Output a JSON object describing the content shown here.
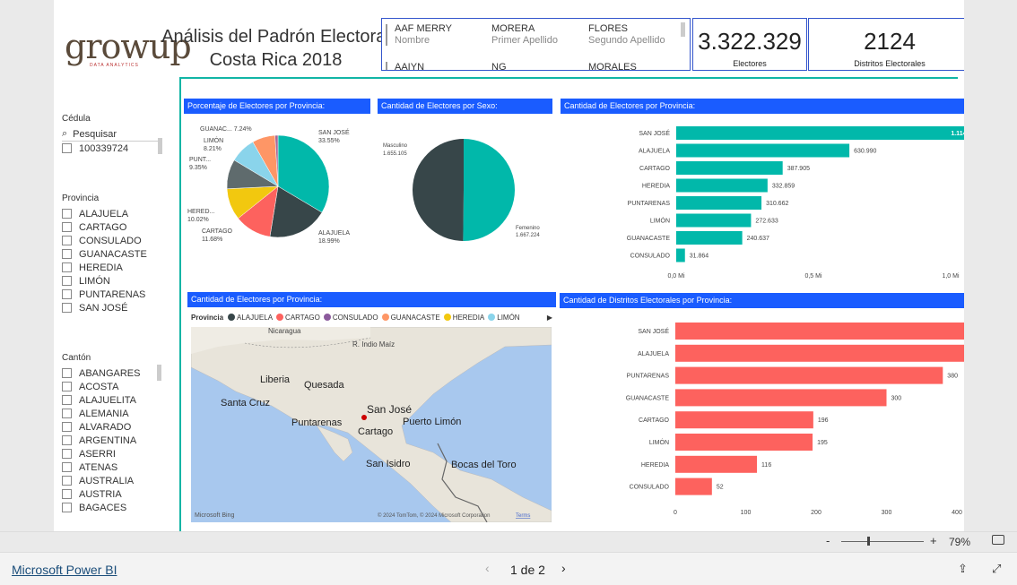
{
  "header": {
    "logo_main": "growup",
    "logo_sub": "DATA ANALYTICS",
    "title_line1": "Análisis del Padrón Electoral",
    "title_line2": "Costa Rica 2018"
  },
  "name_card": {
    "nombre_value": "AAF MERRY",
    "nombre_label": "Nombre",
    "primer_value": "MORERA",
    "primer_label": "Primer Apellido",
    "segundo_value": "FLORES",
    "segundo_label": "Segundo Apellido",
    "next_nombre": "AAIYN",
    "next_primer": "NG",
    "next_segundo": "MORALES"
  },
  "kpi_electores": {
    "value": "3.322.329",
    "label": "Electores"
  },
  "kpi_distritos": {
    "value": "2124",
    "label": "Distritos Electorales"
  },
  "slicer_cedula": {
    "label": "Cédula",
    "search_placeholder": "Pesquisar",
    "items": [
      "100339724"
    ]
  },
  "slicer_provincia": {
    "label": "Provincia",
    "items": [
      "ALAJUELA",
      "CARTAGO",
      "CONSULADO",
      "GUANACASTE",
      "HEREDIA",
      "LIMÓN",
      "PUNTARENAS",
      "SAN JOSÉ"
    ]
  },
  "slicer_canton": {
    "label": "Cantón",
    "items": [
      "ABANGARES",
      "ACOSTA",
      "ALAJUELITA",
      "ALEMANIA",
      "ALVARADO",
      "ARGENTINA",
      "ASERRI",
      "ATENAS",
      "AUSTRALIA",
      "AUSTRIA",
      "BAGACES"
    ]
  },
  "visual_titles": {
    "pct_provincia": "Porcentaje de Electores por Provincia:",
    "sexo": "Cantidad de Electores por Sexo:",
    "cant_provincia": "Cantidad de Electores por Provincia:",
    "map": "Cantidad de Electores por Provincia:",
    "distritos": "Cantidad de Distritos Electorales por Provincia:"
  },
  "map": {
    "legend_title": "Provincia",
    "legend": [
      {
        "name": "ALAJUELA",
        "color": "#374649"
      },
      {
        "name": "CARTAGO",
        "color": "#fd625e"
      },
      {
        "name": "CONSULADO",
        "color": "#8b5a9c"
      },
      {
        "name": "GUANACASTE",
        "color": "#fe9666"
      },
      {
        "name": "HEREDIA",
        "color": "#f2c80f"
      },
      {
        "name": "LIMÓN",
        "color": "#8ad4eb"
      }
    ],
    "labels": [
      {
        "text": "Nicaragua"
      },
      {
        "text": "R. Indio Maíz"
      },
      {
        "text": "Liberia"
      },
      {
        "text": "Quesada"
      },
      {
        "text": "Santa Cruz"
      },
      {
        "text": "San José"
      },
      {
        "text": "Puntarenas"
      },
      {
        "text": "Puerto Limón"
      },
      {
        "text": "Cartago"
      },
      {
        "text": "San Isidro"
      },
      {
        "text": "Bocas del Toro"
      }
    ],
    "bing": "Microsoft Bing",
    "copyright": "© 2024 TomTom, © 2024 Microsoft Corporation",
    "terms": "Terms"
  },
  "chart_data": [
    {
      "type": "pie",
      "title": "Porcentaje de Electores por Provincia:",
      "categories": [
        "SAN JOSÉ",
        "ALAJUELA",
        "CARTAGO",
        "HEREDIA",
        "PUNTARENAS",
        "LIMÓN",
        "GUANACASTE",
        "CONSULADO"
      ],
      "display_labels": [
        "SAN JOSÉ",
        "ALAJUELA",
        "CARTAGO",
        "HERED...",
        "PUNT...",
        "LIMÓN",
        "GUANAC...",
        ""
      ],
      "values": [
        33.55,
        18.99,
        11.68,
        10.02,
        9.35,
        8.21,
        7.24,
        0.96
      ],
      "value_labels": [
        "33.55%",
        "18.99%",
        "11.68%",
        "10.02%",
        "9.35%",
        "8.21%",
        "7.24%",
        ""
      ],
      "colors": [
        "#01b8aa",
        "#374649",
        "#fd625e",
        "#f2c80f",
        "#5f6b6d",
        "#8ad4eb",
        "#fe9666",
        "#a66999"
      ]
    },
    {
      "type": "pie",
      "title": "Cantidad de Electores por Sexo:",
      "categories": [
        "Femenino",
        "Masculino"
      ],
      "values": [
        1667224,
        1655105
      ],
      "value_labels": [
        "1.667.224",
        "1.655.105"
      ],
      "colors": [
        "#01b8aa",
        "#374649"
      ]
    },
    {
      "type": "bar",
      "orientation": "horizontal",
      "title": "Cantidad de Electores por Provincia:",
      "categories": [
        "SAN JOSÉ",
        "ALAJUELA",
        "CARTAGO",
        "HEREDIA",
        "PUNTARENAS",
        "LIMÓN",
        "GUANACASTE",
        "CONSULADO"
      ],
      "values": [
        1114779,
        630990,
        387905,
        332859,
        310662,
        272633,
        240637,
        31864
      ],
      "value_labels": [
        "1.114.779",
        "630.990",
        "387.905",
        "332.859",
        "310.662",
        "272.633",
        "240.637",
        "31.864"
      ],
      "xlim": [
        0,
        1000000
      ],
      "ticks": [
        {
          "v": 0,
          "label": "0,0 Mi"
        },
        {
          "v": 500000,
          "label": "0,5 Mi"
        },
        {
          "v": 1000000,
          "label": "1,0 Mi"
        }
      ],
      "color": "#01b8aa"
    },
    {
      "type": "bar",
      "orientation": "horizontal",
      "title": "Cantidad de Distritos Electorales por Provincia:",
      "categories": [
        "SAN JOSÉ",
        "ALAJUELA",
        "PUNTARENAS",
        "GUANACASTE",
        "CARTAGO",
        "LIMÓN",
        "HEREDIA",
        "CONSULADO"
      ],
      "values": [
        446,
        439,
        380,
        300,
        196,
        195,
        116,
        52
      ],
      "value_labels": [
        "446",
        "439",
        "380",
        "300",
        "196",
        "195",
        "116",
        "52"
      ],
      "xlim": [
        0,
        400
      ],
      "ticks": [
        {
          "v": 0,
          "label": "0"
        },
        {
          "v": 100,
          "label": "100"
        },
        {
          "v": 200,
          "label": "200"
        },
        {
          "v": 300,
          "label": "300"
        },
        {
          "v": 400,
          "label": "400"
        }
      ],
      "color": "#fd625e"
    }
  ],
  "zoom": {
    "minus": "-",
    "plus": "+",
    "value": "79%",
    "level": 0.79
  },
  "footer": {
    "brand": "Microsoft Power BI",
    "pager": "1 de 2"
  }
}
